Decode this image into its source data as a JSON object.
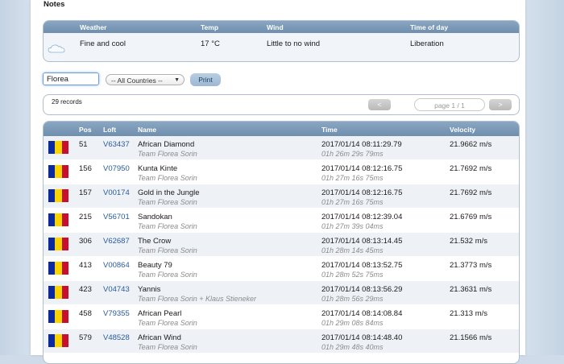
{
  "notes": {
    "title": "Notes"
  },
  "weather": {
    "headers": {
      "weather": "Weather",
      "temp": "Temp",
      "wind": "Wind",
      "time": "Time of day"
    },
    "icon": "cloud-icon",
    "values": {
      "weather": "Fine and cool",
      "temp": "17 °C",
      "wind": "Little to no wind",
      "time": "Liberation"
    }
  },
  "filter": {
    "search_value": "Florea",
    "country_select": "-- All Countries --",
    "print_label": "Print"
  },
  "records": {
    "count_label": "29 records",
    "prev": "<",
    "next": ">",
    "page_info": "page 1 / 1"
  },
  "results": {
    "headers": {
      "pos": "Pos",
      "loft": "Loft",
      "name": "Name",
      "time": "Time",
      "velocity": "Velocity"
    },
    "flag_colors": [
      "#0b2a9e",
      "#fbd300",
      "#c8102e"
    ],
    "rows": [
      {
        "pos": "51",
        "loft": "V63437",
        "name": "African Diamond",
        "team": "Team Florea Sorin",
        "time": "2017/01/14 08:11:29.79",
        "duration": "01h 26m 29s 79ms",
        "velocity": "21.9662 m/s"
      },
      {
        "pos": "156",
        "loft": "V07950",
        "name": "Kunta Kinte",
        "team": "Team Florea Sorin",
        "time": "2017/01/14 08:12:16.75",
        "duration": "01h 27m 16s 75ms",
        "velocity": "21.7692 m/s"
      },
      {
        "pos": "157",
        "loft": "V00174",
        "name": "Gold in the Jungle",
        "team": "Team Florea Sorin",
        "time": "2017/01/14 08:12:16.75",
        "duration": "01h 27m 16s 75ms",
        "velocity": "21.7692 m/s"
      },
      {
        "pos": "215",
        "loft": "V56701",
        "name": "Sandokan",
        "team": "Team Florea Sorin",
        "time": "2017/01/14 08:12:39.04",
        "duration": "01h 27m 39s 04ms",
        "velocity": "21.6769 m/s"
      },
      {
        "pos": "306",
        "loft": "V62687",
        "name": "The Crow",
        "team": "Team Florea Sorin",
        "time": "2017/01/14 08:13:14.45",
        "duration": "01h 28m 14s 45ms",
        "velocity": "21.532 m/s"
      },
      {
        "pos": "413",
        "loft": "V00864",
        "name": "Beauty 79",
        "team": "Team Florea Sorin",
        "time": "2017/01/14 08:13:52.75",
        "duration": "01h 28m 52s 75ms",
        "velocity": "21.3773 m/s"
      },
      {
        "pos": "423",
        "loft": "V04743",
        "name": "Yannis",
        "team": "Team Florea Sorin + Klaus Stieneker",
        "time": "2017/01/14 08:13:56.29",
        "duration": "01h 28m 56s 29ms",
        "velocity": "21.3631 m/s"
      },
      {
        "pos": "458",
        "loft": "V79355",
        "name": "African Pearl",
        "team": "Team Florea Sorin",
        "time": "2017/01/14 08:14:08.84",
        "duration": "01h 29m 08s 84ms",
        "velocity": "21.313 m/s"
      },
      {
        "pos": "579",
        "loft": "V48528",
        "name": "African Wind",
        "team": "Team Florea Sorin",
        "time": "2017/01/14 08:14:48.40",
        "duration": "01h 29m 48s 40ms",
        "velocity": "21.1566 m/s"
      }
    ]
  }
}
